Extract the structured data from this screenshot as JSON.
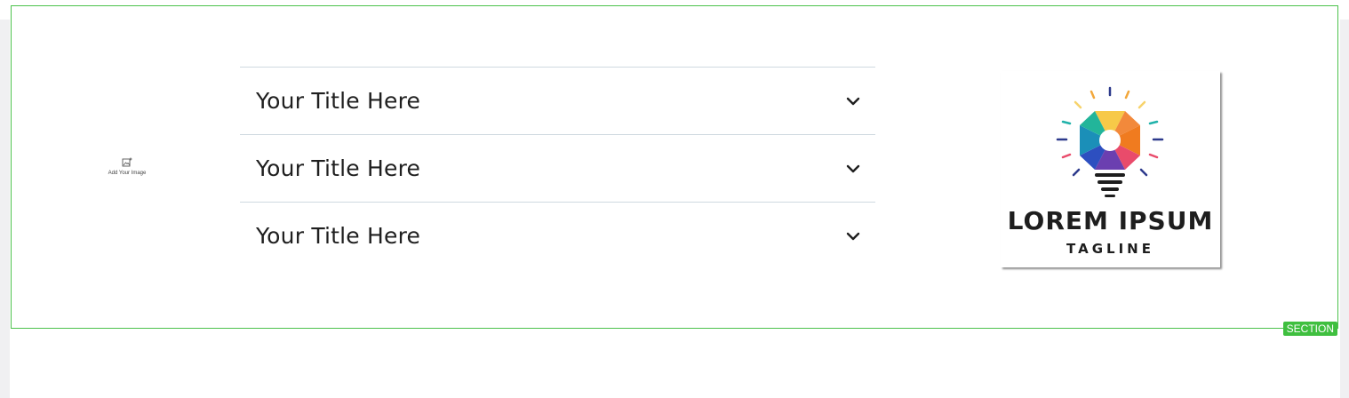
{
  "section": {
    "badge_label": "SECTION",
    "outline_color": "#4cc24c"
  },
  "image_placeholder": {
    "icon": "image-add-icon",
    "label": "Add Your Image"
  },
  "accordion": {
    "items": [
      {
        "title": "Your Title Here",
        "icon": "chevron-down-icon"
      },
      {
        "title": "Your Title Here",
        "icon": "chevron-down-icon"
      },
      {
        "title": "Your Title Here",
        "icon": "chevron-down-icon"
      }
    ]
  },
  "logo": {
    "title": "LOREM IPSUM",
    "tagline": "TAGLINE",
    "icon": "lightbulb-icon"
  }
}
